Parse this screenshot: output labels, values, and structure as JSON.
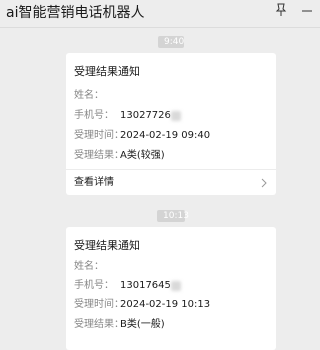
{
  "window": {
    "title": "ai智能营销电话机器人"
  },
  "messages": [
    {
      "time": "9:40",
      "card": {
        "title": "受理结果通知",
        "rows": [
          {
            "label": "姓名：",
            "value": ""
          },
          {
            "label": "手机号：",
            "value": "13027726"
          },
          {
            "label": "受理时间：",
            "value": "2024-02-19 09:40"
          },
          {
            "label": "受理结果：",
            "value": "A类(较强)"
          }
        ],
        "action_label": "查看详情"
      }
    },
    {
      "time": "10:13",
      "card": {
        "title": "受理结果通知",
        "rows": [
          {
            "label": "姓名：",
            "value": ""
          },
          {
            "label": "手机号：",
            "value": "13017645"
          },
          {
            "label": "受理时间：",
            "value": "2024-02-19 10:13"
          },
          {
            "label": "受理结果：",
            "value": "B类(一般)"
          }
        ]
      }
    }
  ],
  "icons": {
    "pin": "pin-icon",
    "minimize": "minimize-icon",
    "chevron": "chevron-right-icon"
  },
  "colors": {
    "background": "#ededed",
    "card": "#ffffff",
    "time_pill": "#d4d4d4"
  }
}
